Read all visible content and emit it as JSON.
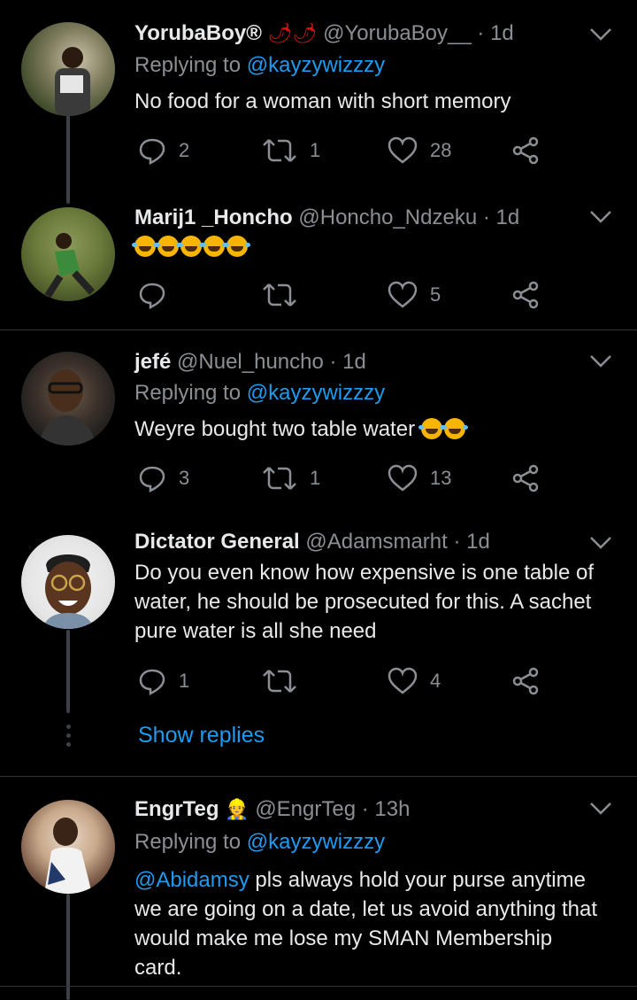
{
  "tweets": [
    {
      "name": "YorubaBoy®",
      "name_emoji": "🌶🌶",
      "handle": "@YorubaBoy__",
      "time": "· 1d",
      "reply_prefix": "Replying to",
      "reply_to": "@kayzywizzzy",
      "text": "No food for a woman with short memory",
      "replies": "2",
      "retweets": "1",
      "likes": "28"
    },
    {
      "name": "Marij1 _Honcho",
      "handle": "@Honcho_Ndzeku",
      "time": "· 1d",
      "emoji_count": 5,
      "replies": "",
      "retweets": "",
      "likes": "5"
    },
    {
      "name": "jefé",
      "handle": "@Nuel_huncho",
      "time": "· 1d",
      "reply_prefix": "Replying to",
      "reply_to": "@kayzywizzzy",
      "text": "Weyre bought two table water",
      "emoji_count": 2,
      "replies": "3",
      "retweets": "1",
      "likes": "13"
    },
    {
      "name": "Dictator General",
      "handle": "@Adamsmarht",
      "time": "· 1d",
      "text_lines": [
        "Do you even know how expensive is one table of",
        "water, he should be prosecuted for this. A sachet",
        "pure water is all she need"
      ],
      "replies": "1",
      "retweets": "",
      "likes": "4"
    },
    {
      "name": "EngrTeg",
      "name_emoji": "👷",
      "handle": "@EngrTeg",
      "time": "· 13h",
      "reply_prefix": "Replying to",
      "reply_to": "@kayzywizzzy",
      "mention": "@Abidamsy",
      "text_first": " pls always hold your purse anytime",
      "text_lines": [
        "we are going on a date, let us avoid anything that",
        "would make me lose my SMAN Membership",
        "card."
      ]
    }
  ],
  "show_replies_label": "Show replies",
  "colors": {
    "background": "#000000",
    "link": "#1d9bf0",
    "muted": "#8b8f94",
    "text": "#e7e9ea"
  }
}
